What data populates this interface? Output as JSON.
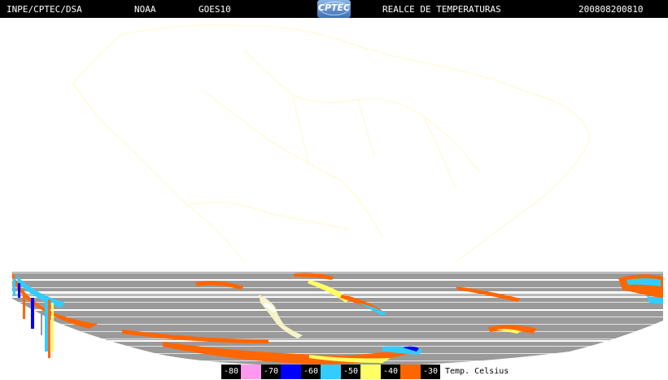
{
  "header": {
    "institution": "INPE/CPTEC/DSA",
    "agency": "NOAA",
    "satellite": "GOES10",
    "logo_text": "CPTEC",
    "product": "REALCE DE TEMPERATURAS",
    "timestamp": "200808200810"
  },
  "image": {
    "background_color": "#ffffff",
    "coastline_color": "#fffde8",
    "cloud_gray": "#9a9a9a",
    "ice_color": "#f5f3c8"
  },
  "legend": {
    "items": [
      {
        "label": "-80",
        "color": "#ff99ee"
      },
      {
        "label": "-70",
        "color": "#0000ff"
      },
      {
        "label": "-60",
        "color": "#33ccff"
      },
      {
        "label": "-50",
        "color": "#ffff66"
      },
      {
        "label": "-40",
        "color": "#ff6600"
      },
      {
        "label": "-30",
        "color": ""
      }
    ],
    "unit": "Temp. Celsius"
  }
}
